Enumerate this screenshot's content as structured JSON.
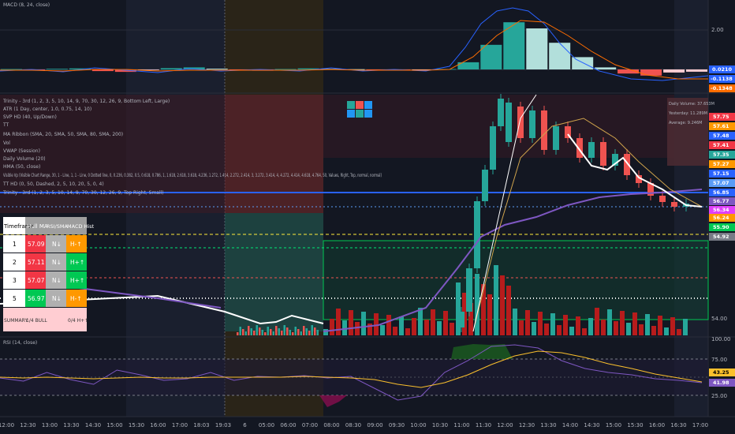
{
  "panes": {
    "macd": {
      "label": "MACD (8, 24, close)",
      "ticks": [
        "2.00"
      ],
      "badges": [
        "0.0210",
        "-0.1138",
        "-0.1348"
      ]
    },
    "price": {
      "ticks": [
        "54.00"
      ],
      "badges": [
        "57.75",
        "57.61",
        "57.48",
        "57.41",
        "57.35",
        "57.27",
        "57.15",
        "57.07",
        "56.85",
        "56.77",
        "56.34",
        "56.24",
        "55.90",
        "54.92"
      ],
      "indicator_labels": [
        "Trinity - 3rd (1, 2, 3, 5, 10, 14, 9, 70, 30, 12, 26, 9, Bottom Left, Large)",
        "ATR (1 Day, center, 1.0, 0.75, 14, 10)",
        "SVP HD (40, Up/Down)",
        "TT",
        "MA Ribbon (SMA, 20, SMA, 50, SMA, 80, SMA, 200)",
        "Vol",
        "VWAP (Session)",
        "Daily Volume (20)",
        "HMA (50, close)",
        "Visible Vp (Visible Chart Range, 30, 1 - Line, 1, 1 - Line, 0 Dotted line, 0, 0.236, 0.382, 0.5, 0.618, 0.786, 1, 1.618, 2.618, 3.618, 4.236, 1.272, 1.414, 2.272, 2.414, 3, 3.272, 3.414, 4, 4.272, 4.414, 4.618, 4.764, 50, Values, Right, Top, normal, normal)",
        "TT HD (0, 50, Dashed, 2, 5, 10, 20, 5, 0, 4)",
        "Trinity - 3rd (1, 2, 3, 5, 10, 14, 9, 70, 30, 12, 26, 9, Top Right, Small)"
      ],
      "table": {
        "headers": [
          "Timeframe",
          "Hull MA",
          "RSI/SMA",
          "MACD Hist"
        ],
        "rows": [
          {
            "tf": "1",
            "hull": "57.09",
            "rsi": "N↓",
            "macd": "H-↑"
          },
          {
            "tf": "2",
            "hull": "57.11",
            "rsi": "N↓",
            "macd": "H+↑"
          },
          {
            "tf": "3",
            "hull": "57.07",
            "rsi": "N↓",
            "macd": "H+↑"
          },
          {
            "tf": "5",
            "hull": "56.97",
            "rsi": "N↓",
            "macd": "H-↑"
          }
        ],
        "summary": {
          "label": "SUMMARY",
          "hull": "1/4 BULL",
          "macd": "0/4 H+↑"
        }
      },
      "daily_box": {
        "l1": "Daily Volume: 37.653M",
        "l2": "Yesterday: 11.289M",
        "l3": "Average: 9.246M"
      }
    },
    "rsi": {
      "label": "RSI (14, close)",
      "ticks": [
        "100.00",
        "75.00",
        "25.00"
      ],
      "badges": [
        "43.25",
        "41.98"
      ]
    }
  },
  "time_axis": [
    "12:00",
    "12:30",
    "13:00",
    "13:30",
    "14:30",
    "15:00",
    "15:30",
    "16:00",
    "17:00",
    "18:03",
    "19:03",
    "6",
    "05:00",
    "06:00",
    "07:00",
    "08:00",
    "08:30",
    "09:00",
    "09:30",
    "10:00",
    "10:30",
    "11:00",
    "11:30",
    "12:00",
    "12:30",
    "13:30",
    "14:00",
    "14:30",
    "15:00",
    "15:30",
    "16:00",
    "16:30",
    "17:00"
  ],
  "colors": {
    "bg": "#131722",
    "bull": "#26a69a",
    "bear": "#ef5350",
    "macd_line": "#2962ff",
    "signal_line": "#ff6d00",
    "rsi_line": "#7e57c2",
    "rsi_sma": "#fbc02d"
  },
  "chart_data": [
    {
      "type": "bar",
      "title": "MACD (8, 24, close)",
      "series": [
        {
          "name": "MACD",
          "values": [
            0.02,
            -0.05,
            0.03,
            0.05,
            -0.08,
            -0.12,
            -0.03,
            0.06,
            0.1,
            0.04,
            -0.04,
            -0.06,
            0.02,
            0.05,
            0.03,
            0.01,
            -0.02,
            -0.04,
            -0.03,
            0.02,
            0.35,
            1.2,
            2.3,
            2.0,
            1.3,
            0.6,
            0.1,
            -0.2,
            -0.3,
            -0.15,
            -0.11
          ]
        }
      ]
    },
    {
      "type": "line",
      "title": "RSI (14, close)",
      "ylim": [
        0,
        100
      ],
      "series": [
        {
          "name": "RSI",
          "values": [
            48,
            44,
            55,
            46,
            40,
            58,
            52,
            45,
            47,
            55,
            45,
            50,
            49,
            51,
            48,
            50,
            35,
            20,
            25,
            55,
            70,
            88,
            90,
            86,
            70,
            60,
            55,
            52,
            47,
            45,
            42
          ]
        },
        {
          "name": "SMA",
          "values": [
            49,
            48,
            49,
            48,
            47,
            48,
            49,
            48,
            48,
            49,
            49,
            49,
            49,
            50,
            49,
            48,
            46,
            40,
            36,
            42,
            52,
            65,
            76,
            82,
            80,
            74,
            66,
            60,
            53,
            48,
            43
          ]
        }
      ]
    }
  ]
}
